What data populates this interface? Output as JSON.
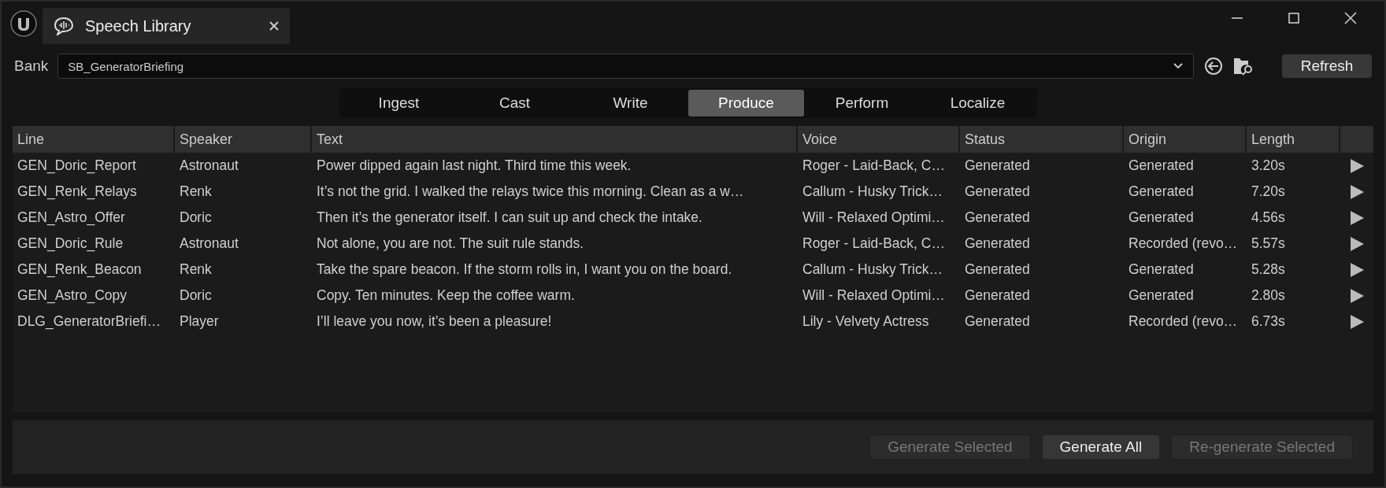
{
  "window": {
    "title": "Speech Library"
  },
  "bank": {
    "label": "Bank",
    "value": "SB_GeneratorBriefing"
  },
  "refresh_button": "Refresh",
  "tabs": [
    {
      "label": "Ingest",
      "selected": false
    },
    {
      "label": "Cast",
      "selected": false
    },
    {
      "label": "Write",
      "selected": false
    },
    {
      "label": "Produce",
      "selected": true
    },
    {
      "label": "Perform",
      "selected": false
    },
    {
      "label": "Localize",
      "selected": false
    }
  ],
  "table": {
    "columns": [
      "Line",
      "Speaker",
      "Text",
      "Voice",
      "Status",
      "Origin",
      "Length"
    ],
    "rows": [
      {
        "line": "GEN_Doric_Report",
        "speaker": "Astronaut",
        "text": "Power dipped again last night. Third time this week.",
        "voice": "Roger - Laid-Back, C…",
        "status": "Generated",
        "origin": "Generated",
        "length": "3.20s"
      },
      {
        "line": "GEN_Renk_Relays",
        "speaker": "Renk",
        "text": "It’s not the grid. I walked the relays twice this morning. Clean as a w…",
        "voice": "Callum - Husky Trick…",
        "status": "Generated",
        "origin": "Generated",
        "length": "7.20s"
      },
      {
        "line": "GEN_Astro_Offer",
        "speaker": "Doric",
        "text": "Then it’s the generator itself. I can suit up and check the intake.",
        "voice": "Will - Relaxed Optimi…",
        "status": "Generated",
        "origin": "Generated",
        "length": "4.56s"
      },
      {
        "line": "GEN_Doric_Rule",
        "speaker": "Astronaut",
        "text": "Not alone, you are not. The suit rule stands.",
        "voice": "Roger - Laid-Back, C…",
        "status": "Generated",
        "origin": "Recorded (revo…",
        "length": "5.57s"
      },
      {
        "line": "GEN_Renk_Beacon",
        "speaker": "Renk",
        "text": "Take the spare beacon. If the storm rolls in, I want you on the board.",
        "voice": "Callum - Husky Trick…",
        "status": "Generated",
        "origin": "Generated",
        "length": "5.28s"
      },
      {
        "line": "GEN_Astro_Copy",
        "speaker": "Doric",
        "text": "Copy. Ten minutes. Keep the coffee warm.",
        "voice": "Will - Relaxed Optimi…",
        "status": "Generated",
        "origin": "Generated",
        "length": "2.80s"
      },
      {
        "line": "DLG_GeneratorBriefi…",
        "speaker": "Player",
        "text": "I’ll leave you now, it’s been a pleasure!",
        "voice": "Lily - Velvety Actress",
        "status": "Generated",
        "origin": "Recorded (revo…",
        "length": "6.73s"
      }
    ]
  },
  "actions": [
    {
      "label": "Generate Selected",
      "disabled": true
    },
    {
      "label": "Generate All",
      "disabled": false
    },
    {
      "label": "Re-generate Selected",
      "disabled": true
    }
  ]
}
